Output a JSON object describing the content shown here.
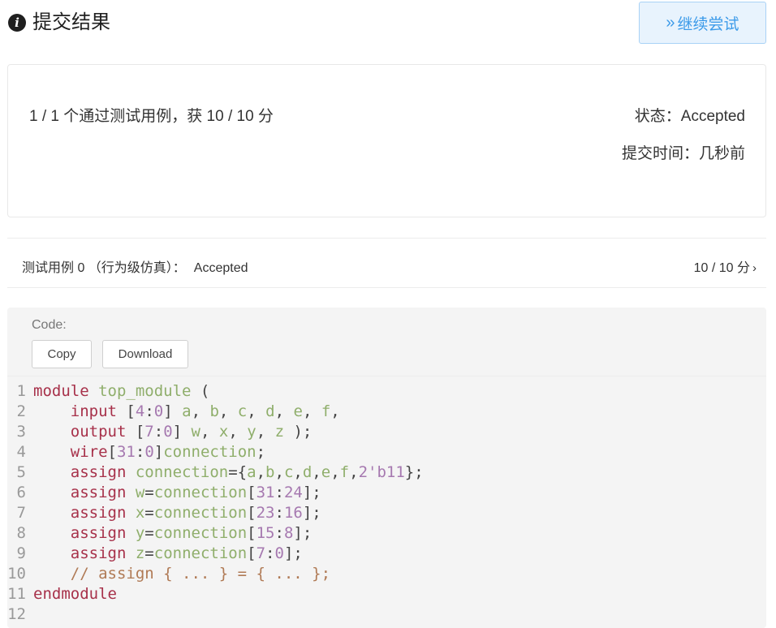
{
  "header": {
    "icon": "info-icon",
    "title": "提交结果",
    "retry_chevron": "»",
    "retry_label": "继续尝试"
  },
  "summary": {
    "pass_text": "1 / 1 个通过测试用例，获 10 / 10 分",
    "status_label": "状态：",
    "status_value": "Accepted",
    "time_label": "提交时间：",
    "time_value": "几秒前"
  },
  "testcase": {
    "label": "测试用例 0 （行为级仿真）：",
    "result": "Accepted",
    "score": "10 / 10 分",
    "arrow": "›"
  },
  "code": {
    "label": "Code:",
    "copy_label": "Copy",
    "download_label": "Download",
    "lines": [
      {
        "n": "1",
        "t": [
          [
            "kw",
            "module "
          ],
          [
            "id",
            "top_module "
          ],
          [
            "pn",
            "("
          ]
        ]
      },
      {
        "n": "2",
        "t": [
          [
            "pn",
            "    "
          ],
          [
            "kw",
            "input "
          ],
          [
            "pn",
            "["
          ],
          [
            "num",
            "4"
          ],
          [
            "pn",
            ":"
          ],
          [
            "num",
            "0"
          ],
          [
            "pn",
            "] "
          ],
          [
            "id",
            "a"
          ],
          [
            "pn",
            ", "
          ],
          [
            "id",
            "b"
          ],
          [
            "pn",
            ", "
          ],
          [
            "id",
            "c"
          ],
          [
            "pn",
            ", "
          ],
          [
            "id",
            "d"
          ],
          [
            "pn",
            ", "
          ],
          [
            "id",
            "e"
          ],
          [
            "pn",
            ", "
          ],
          [
            "id",
            "f"
          ],
          [
            "pn",
            ","
          ]
        ]
      },
      {
        "n": "3",
        "t": [
          [
            "pn",
            "    "
          ],
          [
            "kw",
            "output "
          ],
          [
            "pn",
            "["
          ],
          [
            "num",
            "7"
          ],
          [
            "pn",
            ":"
          ],
          [
            "num",
            "0"
          ],
          [
            "pn",
            "] "
          ],
          [
            "id",
            "w"
          ],
          [
            "pn",
            ", "
          ],
          [
            "id",
            "x"
          ],
          [
            "pn",
            ", "
          ],
          [
            "id",
            "y"
          ],
          [
            "pn",
            ", "
          ],
          [
            "id",
            "z"
          ],
          [
            "pn",
            " );"
          ]
        ]
      },
      {
        "n": "4",
        "t": [
          [
            "pn",
            "    "
          ],
          [
            "kw",
            "wire"
          ],
          [
            "pn",
            "["
          ],
          [
            "num",
            "31"
          ],
          [
            "pn",
            ":"
          ],
          [
            "num",
            "0"
          ],
          [
            "pn",
            "]"
          ],
          [
            "id",
            "connection"
          ],
          [
            "pn",
            ";"
          ]
        ]
      },
      {
        "n": "5",
        "t": [
          [
            "pn",
            "    "
          ],
          [
            "kw",
            "assign "
          ],
          [
            "id",
            "connection"
          ],
          [
            "pn",
            "={"
          ],
          [
            "id",
            "a"
          ],
          [
            "pn",
            ","
          ],
          [
            "id",
            "b"
          ],
          [
            "pn",
            ","
          ],
          [
            "id",
            "c"
          ],
          [
            "pn",
            ","
          ],
          [
            "id",
            "d"
          ],
          [
            "pn",
            ","
          ],
          [
            "id",
            "e"
          ],
          [
            "pn",
            ","
          ],
          [
            "id",
            "f"
          ],
          [
            "pn",
            ","
          ],
          [
            "num",
            "2'b11"
          ],
          [
            "pn",
            "};"
          ]
        ]
      },
      {
        "n": "6",
        "t": [
          [
            "pn",
            "    "
          ],
          [
            "kw",
            "assign "
          ],
          [
            "id",
            "w"
          ],
          [
            "pn",
            "="
          ],
          [
            "id",
            "connection"
          ],
          [
            "pn",
            "["
          ],
          [
            "num",
            "31"
          ],
          [
            "pn",
            ":"
          ],
          [
            "num",
            "24"
          ],
          [
            "pn",
            "];"
          ]
        ]
      },
      {
        "n": "7",
        "t": [
          [
            "pn",
            "    "
          ],
          [
            "kw",
            "assign "
          ],
          [
            "id",
            "x"
          ],
          [
            "pn",
            "="
          ],
          [
            "id",
            "connection"
          ],
          [
            "pn",
            "["
          ],
          [
            "num",
            "23"
          ],
          [
            "pn",
            ":"
          ],
          [
            "num",
            "16"
          ],
          [
            "pn",
            "];"
          ]
        ]
      },
      {
        "n": "8",
        "t": [
          [
            "pn",
            "    "
          ],
          [
            "kw",
            "assign "
          ],
          [
            "id",
            "y"
          ],
          [
            "pn",
            "="
          ],
          [
            "id",
            "connection"
          ],
          [
            "pn",
            "["
          ],
          [
            "num",
            "15"
          ],
          [
            "pn",
            ":"
          ],
          [
            "num",
            "8"
          ],
          [
            "pn",
            "];"
          ]
        ]
      },
      {
        "n": "9",
        "t": [
          [
            "pn",
            "    "
          ],
          [
            "kw",
            "assign "
          ],
          [
            "id",
            "z"
          ],
          [
            "pn",
            "="
          ],
          [
            "id",
            "connection"
          ],
          [
            "pn",
            "["
          ],
          [
            "num",
            "7"
          ],
          [
            "pn",
            ":"
          ],
          [
            "num",
            "0"
          ],
          [
            "pn",
            "];"
          ]
        ]
      },
      {
        "n": "10",
        "t": [
          [
            "pn",
            "    "
          ],
          [
            "cm",
            "// assign { ... } = { ... };"
          ]
        ]
      },
      {
        "n": "11",
        "t": [
          [
            "kw",
            "endmodule"
          ]
        ]
      },
      {
        "n": "12",
        "t": []
      }
    ]
  },
  "colors": {
    "accent": "#3d9be9",
    "accent_bg": "#e8f3fd",
    "keyword": "#a7314a",
    "identifier": "#8fae6b",
    "number": "#a679b0",
    "comment": "#b07a55",
    "code_bg": "#f4f4f4"
  }
}
